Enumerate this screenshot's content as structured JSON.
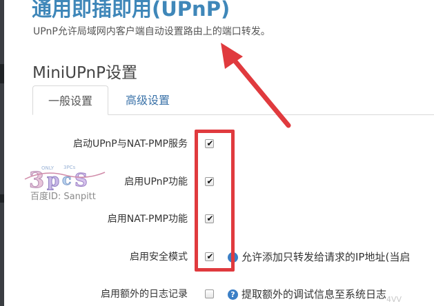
{
  "page": {
    "title": "通用即插即用(UPnP)",
    "description": "UPnP允许局域网内客户端自动设置路由上的端口转发。"
  },
  "section": {
    "title": "MiniUPnP设置"
  },
  "tabs": [
    {
      "label": "一般设置",
      "active": true
    },
    {
      "label": "高级设置",
      "active": false
    }
  ],
  "settings": [
    {
      "label": "启动UPnP与NAT-PMP服务",
      "checked": true,
      "help": ""
    },
    {
      "label": "启用UPnP功能",
      "checked": true,
      "help": ""
    },
    {
      "label": "启用NAT-PMP功能",
      "checked": true,
      "help": ""
    },
    {
      "label": "启用安全模式",
      "checked": true,
      "help": "允许添加只转发给请求的IP地址(当启"
    },
    {
      "label": "启用额外的日志记录",
      "checked": false,
      "help": "提取额外的调试信息至系统日志"
    }
  ],
  "help_icon_glyph": "?",
  "check_glyph": "✔",
  "watermark": {
    "id_text": "百度ID: Sanpitt"
  },
  "corner_text": "4VV",
  "colors": {
    "title": "#3f87b9",
    "link": "#3a72a8",
    "annotation": "#e03a3e",
    "help_icon": "#3b7fc6"
  }
}
